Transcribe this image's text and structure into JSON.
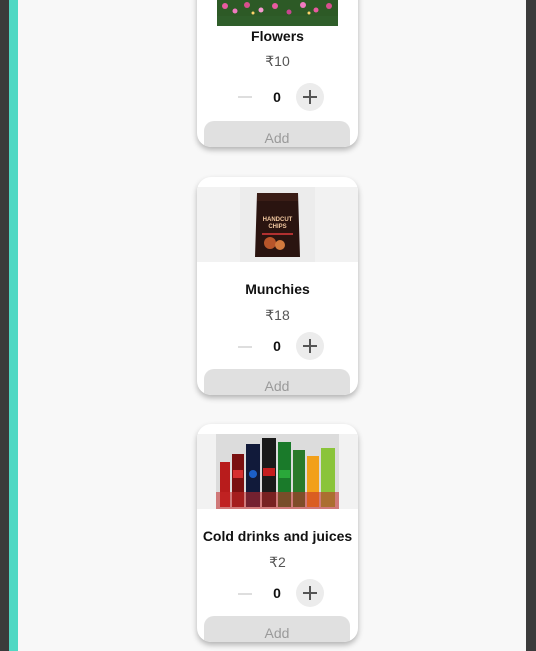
{
  "products": [
    {
      "name": "Flowers",
      "price": "₹10",
      "quantity": "0",
      "add_label": "Add",
      "image_icon": "flowers-image"
    },
    {
      "name": "Munchies",
      "price": "₹18",
      "quantity": "0",
      "add_label": "Add",
      "image_icon": "chips-packet-image"
    },
    {
      "name": "Cold drinks and juices",
      "price": "₹2",
      "quantity": "0",
      "add_label": "Add",
      "image_icon": "soft-drinks-image"
    }
  ],
  "colors": {
    "accent": "#4fd8c3",
    "frame": "#3b3b3b",
    "add_button_bg": "#e0e0e0",
    "add_button_text": "#9a9a9a"
  }
}
